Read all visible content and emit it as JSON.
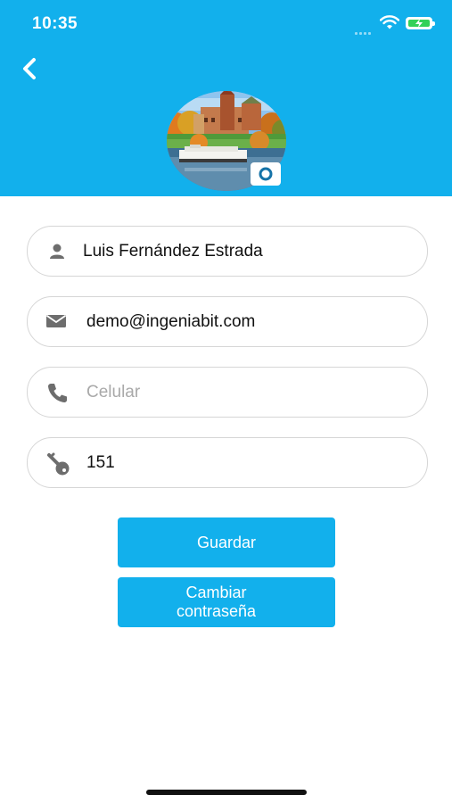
{
  "status_bar": {
    "time": "10:35",
    "signal_icon": "signal-dots-icon",
    "wifi_icon": "wifi-icon",
    "battery_icon": "battery-charging-icon",
    "battery_color": "#33d158"
  },
  "header": {
    "background_color": "#12b0ec",
    "back_icon": "chevron-left-icon",
    "avatar_icon": "profile-photo",
    "camera_icon": "camera-icon"
  },
  "form": {
    "name": {
      "icon": "person-icon",
      "value": "Luis Fernández Estrada",
      "placeholder": ""
    },
    "email": {
      "icon": "envelope-icon",
      "value": "demo@ingeniabit.com",
      "placeholder": ""
    },
    "phone": {
      "icon": "phone-icon",
      "value": "",
      "placeholder": "Celular"
    },
    "key": {
      "icon": "key-icon",
      "value": "151",
      "placeholder": ""
    }
  },
  "actions": {
    "save_label": "Guardar",
    "change_password_line1": "Cambiar",
    "change_password_line2": "contraseña",
    "button_color": "#12b0ec"
  }
}
